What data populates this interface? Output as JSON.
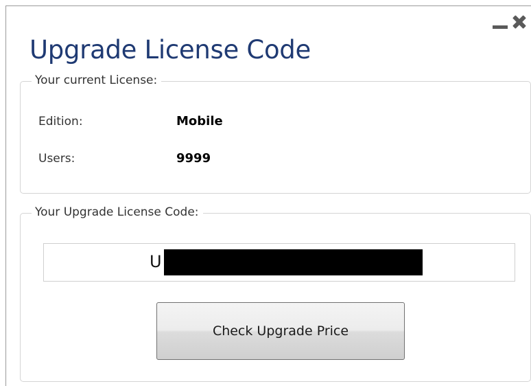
{
  "window": {
    "title": "Upgrade License Code",
    "controls": {
      "minimize_icon": "minimize-icon",
      "close_icon": "close-icon"
    }
  },
  "current_license": {
    "legend": "Your current License:",
    "edition_label": "Edition:",
    "edition_value": "Mobile",
    "users_label": "Users:",
    "users_value": "9999"
  },
  "upgrade": {
    "legend": "Your Upgrade License Code:",
    "code_prefix": "U",
    "button_label": "Check Upgrade Price"
  }
}
